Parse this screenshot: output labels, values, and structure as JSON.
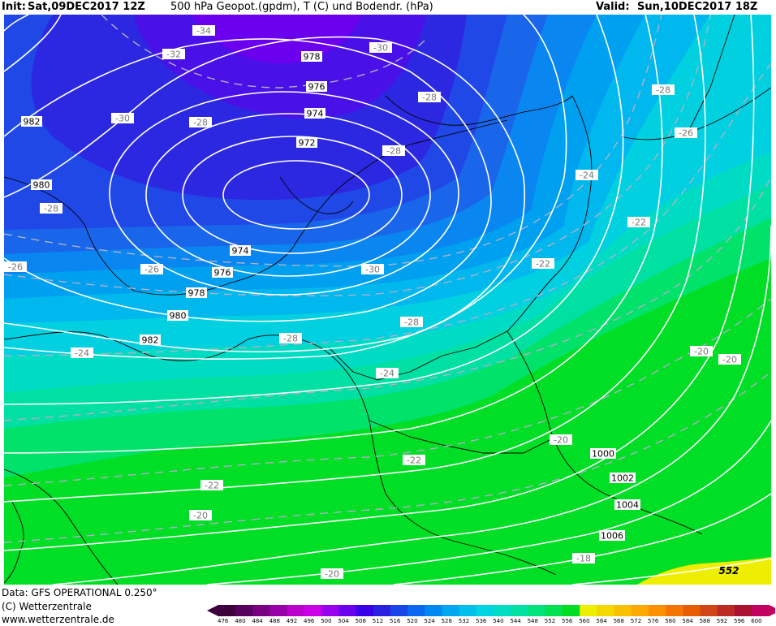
{
  "header": {
    "init_label": "Init:",
    "init_value": "Sat,09DEC2017 12Z",
    "title": "500 hPa Geopot.(gpdm), T (C) und Bodendr. (hPa)",
    "valid_label": "Valid:",
    "valid_value": "Sun,10DEC2017 18Z"
  },
  "footer": {
    "data_source": "Data: GFS OPERATIONAL 0.250°",
    "copyright": "(C) Wetterzentrale",
    "website": "www.wetterzentrale.de"
  },
  "scale": {
    "labels": [
      "476",
      "480",
      "484",
      "488",
      "492",
      "496",
      "500",
      "504",
      "508",
      "512",
      "516",
      "520",
      "524",
      "528",
      "532",
      "536",
      "540",
      "544",
      "548",
      "552",
      "556",
      "560",
      "564",
      "568",
      "572",
      "576",
      "580",
      "584",
      "588",
      "592",
      "596",
      "600"
    ],
    "colors": [
      "#3d003d",
      "#55005f",
      "#7a0082",
      "#9a00aa",
      "#bb00cc",
      "#cc00e6",
      "#9900ee",
      "#6a00ee",
      "#3a00e8",
      "#2a20e0",
      "#1844e8",
      "#0a68f0",
      "#0088f2",
      "#00a6f0",
      "#00c0ea",
      "#00d4e0",
      "#00ddc4",
      "#00e0a0",
      "#00e27a",
      "#00e050",
      "#00dc22",
      "#eeee00",
      "#f4d800",
      "#f8c000",
      "#fca800",
      "#fc9000",
      "#f47600",
      "#e85c00",
      "#d04418",
      "#bc2a26",
      "#aa1230",
      "#c20060"
    ]
  },
  "map": {
    "isobars": [
      "972",
      "974",
      "976",
      "978",
      "980",
      "982",
      "974",
      "976",
      "978",
      "980",
      "982",
      "1000",
      "1002",
      "1004",
      "1006"
    ],
    "temperatures": [
      "-34",
      "-32",
      "-30",
      "-30",
      "-28",
      "-28",
      "-28",
      "-28",
      "-28",
      "-26",
      "-26",
      "-24",
      "-22",
      "-22",
      "-26",
      "-30",
      "-28",
      "-28",
      "-24",
      "-24",
      "-22",
      "-20",
      "-20",
      "-20",
      "-22",
      "-20",
      "-20",
      "-18"
    ],
    "height_label": "552"
  }
}
